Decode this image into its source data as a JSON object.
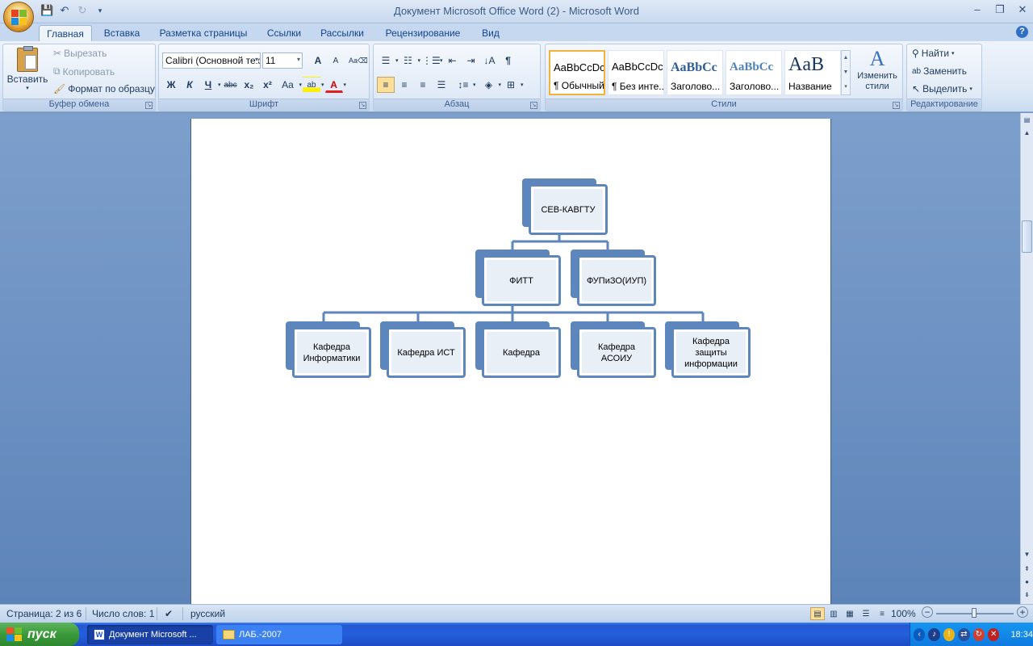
{
  "window": {
    "title": "Документ Microsoft Office Word (2) - Microsoft Word",
    "minimize": "–",
    "restore": "❐",
    "close": "✕"
  },
  "tabs": [
    "Главная",
    "Вставка",
    "Разметка страницы",
    "Ссылки",
    "Рассылки",
    "Рецензирование",
    "Вид"
  ],
  "clipboard": {
    "paste": "Вставить",
    "cut": "Вырезать",
    "copy": "Копировать",
    "format_painter": "Формат по образцу",
    "label": "Буфер обмена"
  },
  "font": {
    "name": "Calibri (Основной текст)",
    "size": "11",
    "bold": "Ж",
    "italic": "К",
    "underline": "Ч",
    "strike": "abc",
    "subscript": "x₂",
    "superscript": "x²",
    "change_case": "Aa",
    "grow": "A",
    "shrink": "A",
    "label": "Шрифт"
  },
  "paragraph": {
    "show_marks": "¶",
    "label": "Абзац"
  },
  "styles": {
    "items": [
      {
        "sample": "AaBbCcDc",
        "name": "¶ Обычный"
      },
      {
        "sample": "AaBbCcDc",
        "name": "¶ Без инте..."
      },
      {
        "sample": "AaBbCc",
        "name": "Заголово..."
      },
      {
        "sample": "AaBbCc",
        "name": "Заголово..."
      },
      {
        "sample": "AaB",
        "name": "Название"
      }
    ],
    "change_styles": "Изменить стили",
    "label": "Стили"
  },
  "editing": {
    "find": "Найти",
    "replace": "Заменить",
    "select": "Выделить",
    "label": "Редактирование"
  },
  "org_chart": {
    "root": "СЕВ-КАВГТУ",
    "level2": [
      "ФИТТ",
      "ФУПиЗО(ИУП)"
    ],
    "level3": [
      "Кафедра Информатики",
      "Кафедра ИСТ",
      "Кафедра",
      "Кафедра АСОИУ",
      "Кафедра защиты информации"
    ]
  },
  "statusbar": {
    "page": "Страница: 2 из 6",
    "words": "Число слов: 1",
    "language": "русский",
    "zoom": "100%",
    "zoom_out": "−",
    "zoom_in": "+"
  },
  "taskbar": {
    "start": "пуск",
    "items": [
      "Документ Microsoft ...",
      "ЛАБ.-2007"
    ],
    "clock": "18:34"
  },
  "colors": {
    "accent": "#5c86bc",
    "ribbon": "#dde8f6"
  }
}
